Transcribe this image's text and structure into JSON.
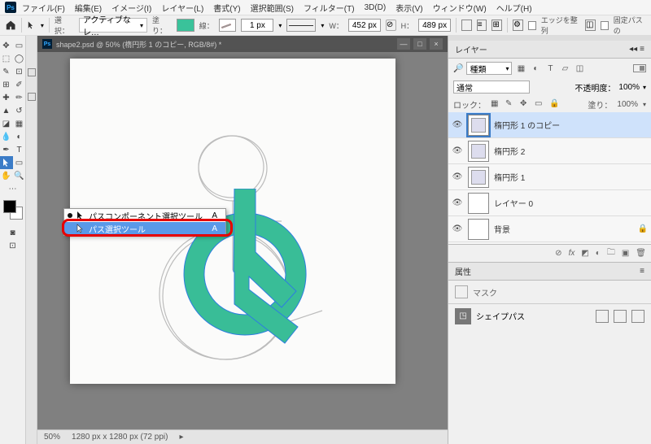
{
  "app": {
    "logo_text": "Ps"
  },
  "menu": [
    "ファイル(F)",
    "編集(E)",
    "イメージ(I)",
    "レイヤー(L)",
    "書式(Y)",
    "選択範囲(S)",
    "フィルター(T)",
    "3D(D)",
    "表示(V)",
    "ウィンドウ(W)",
    "ヘルプ(H)"
  ],
  "options": {
    "select_label": "選択：",
    "select_value": "アクティブなレ…",
    "fill_label": "塗り：",
    "fill_color": "#3ac29a",
    "stroke_label": "線：",
    "stroke_px": "1 px",
    "w_label": "W：",
    "w_value": "452 px",
    "h_label": "H：",
    "h_value": "489 px",
    "align_edges": "エッジを整列",
    "fixed_path": "固定パスの"
  },
  "document": {
    "title": "shape2.psd @ 50% (楕円形 1 のコピー, RGB/8#) *",
    "zoom": "50%",
    "info": "1280 px x 1280 px (72 ppi)"
  },
  "flyout": {
    "items": [
      {
        "label": "パスコンポーネント選択ツール",
        "shortcut": "A",
        "selected": false,
        "dot": true
      },
      {
        "label": "パス選択ツール",
        "shortcut": "A",
        "selected": true,
        "dot": false
      }
    ]
  },
  "layers_panel": {
    "title": "レイヤー",
    "filter_value": "種類",
    "blend_mode": "通常",
    "opacity_label": "不透明度：",
    "opacity_value": "100%",
    "lock_label": "ロック：",
    "fill_label": "塗り：",
    "fill_value": "100%",
    "layers": [
      {
        "name": "楕円形 1 のコピー",
        "selected": true,
        "shape": true,
        "hl": true
      },
      {
        "name": "楕円形 2",
        "selected": false,
        "shape": true
      },
      {
        "name": "楕円形 1",
        "selected": false,
        "shape": true
      },
      {
        "name": "レイヤー 0",
        "selected": false,
        "shape": false
      },
      {
        "name": "背景",
        "selected": false,
        "shape": false,
        "bg": true
      }
    ]
  },
  "properties": {
    "title": "属性",
    "mask_label": "マスク",
    "shape_path_label": "シェイプパス"
  }
}
